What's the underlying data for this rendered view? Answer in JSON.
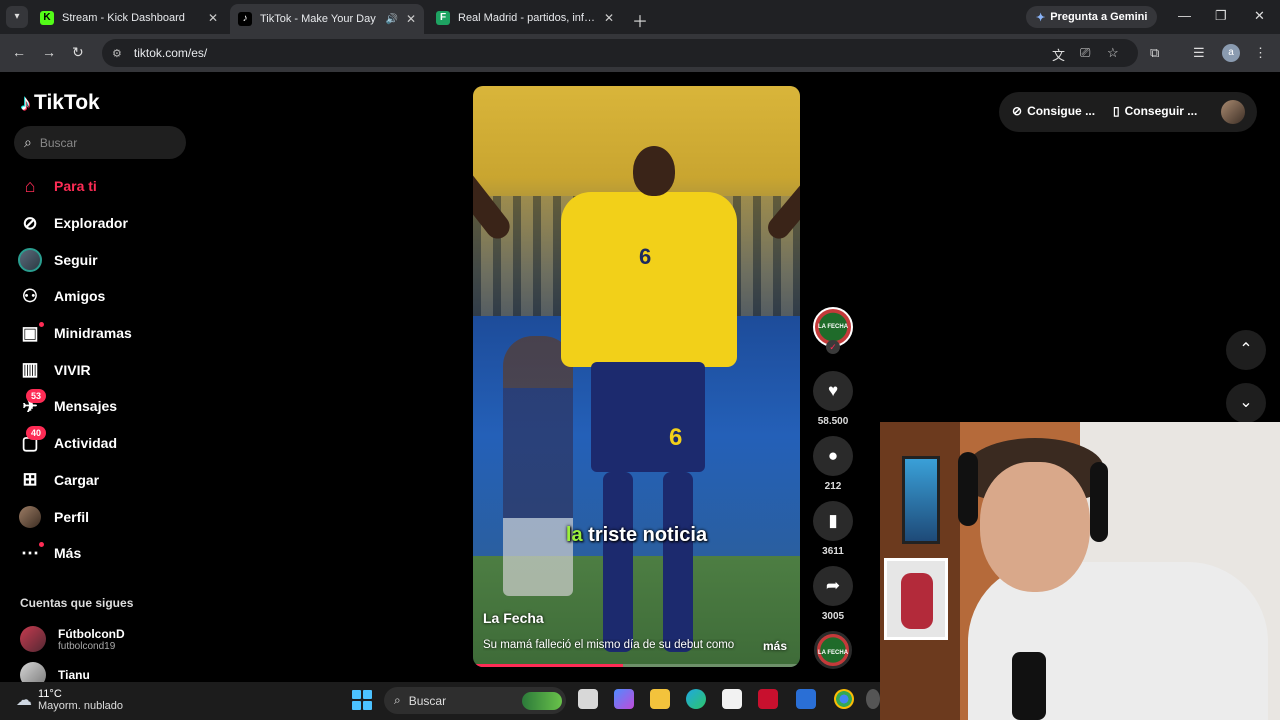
{
  "browser": {
    "tabs": [
      {
        "title": "Stream - Kick Dashboard",
        "favicon": "K",
        "favicon_color": "#53fc18",
        "active": false
      },
      {
        "title": "TikTok - Make Your Day",
        "favicon": "♪",
        "favicon_color": "#000000",
        "active": true
      },
      {
        "title": "Real Madrid - partidos, informa",
        "favicon": "F",
        "favicon_color": "#1ea362",
        "active": false
      }
    ],
    "gemini_label": "Pregunta a Gemini",
    "url": "tiktok.com/es/",
    "profile_initial": "a"
  },
  "sidebar": {
    "logo_text": "TikTok",
    "search_placeholder": "Buscar",
    "items": [
      {
        "label": "Para ti",
        "icon": "home-icon",
        "active": true
      },
      {
        "label": "Explorador",
        "icon": "compass-icon"
      },
      {
        "label": "Seguir",
        "icon": "following-avatar-icon"
      },
      {
        "label": "Amigos",
        "icon": "friends-icon"
      },
      {
        "label": "Minidramas",
        "icon": "film-icon"
      },
      {
        "label": "VIVIR",
        "icon": "live-icon"
      },
      {
        "label": "Mensajes",
        "icon": "messages-icon",
        "badge": "53"
      },
      {
        "label": "Actividad",
        "icon": "activity-icon",
        "badge": "40"
      },
      {
        "label": "Cargar",
        "icon": "upload-icon"
      },
      {
        "label": "Perfil",
        "icon": "profile-avatar-icon"
      },
      {
        "label": "Más",
        "icon": "more-icon"
      }
    ],
    "following_title": "Cuentas que sigues",
    "following": [
      {
        "name": "FútbolconD",
        "handle": "futbolcond19"
      },
      {
        "name": "Tianu",
        "handle": ""
      }
    ]
  },
  "video": {
    "caption_highlight": "la",
    "caption_rest": "triste noticia",
    "author": "La Fecha",
    "description": "Su mamá falleció el mismo día de su debut como",
    "more_label": "más",
    "progress": 0.46,
    "shirt_number": "6",
    "channel_badge": "LA FECHA"
  },
  "actions": {
    "likes": "58.500",
    "comments": "212",
    "saves": "3611",
    "shares": "3005"
  },
  "top_right": {
    "coins_label": "Consigue ...",
    "app_label": "Conseguir ..."
  },
  "taskbar": {
    "temperature": "11°C",
    "condition": "Mayorm. nublado",
    "search_label": "Buscar"
  },
  "colors": {
    "accent": "#fe2c55",
    "highlight_green": "#9bef3d"
  }
}
